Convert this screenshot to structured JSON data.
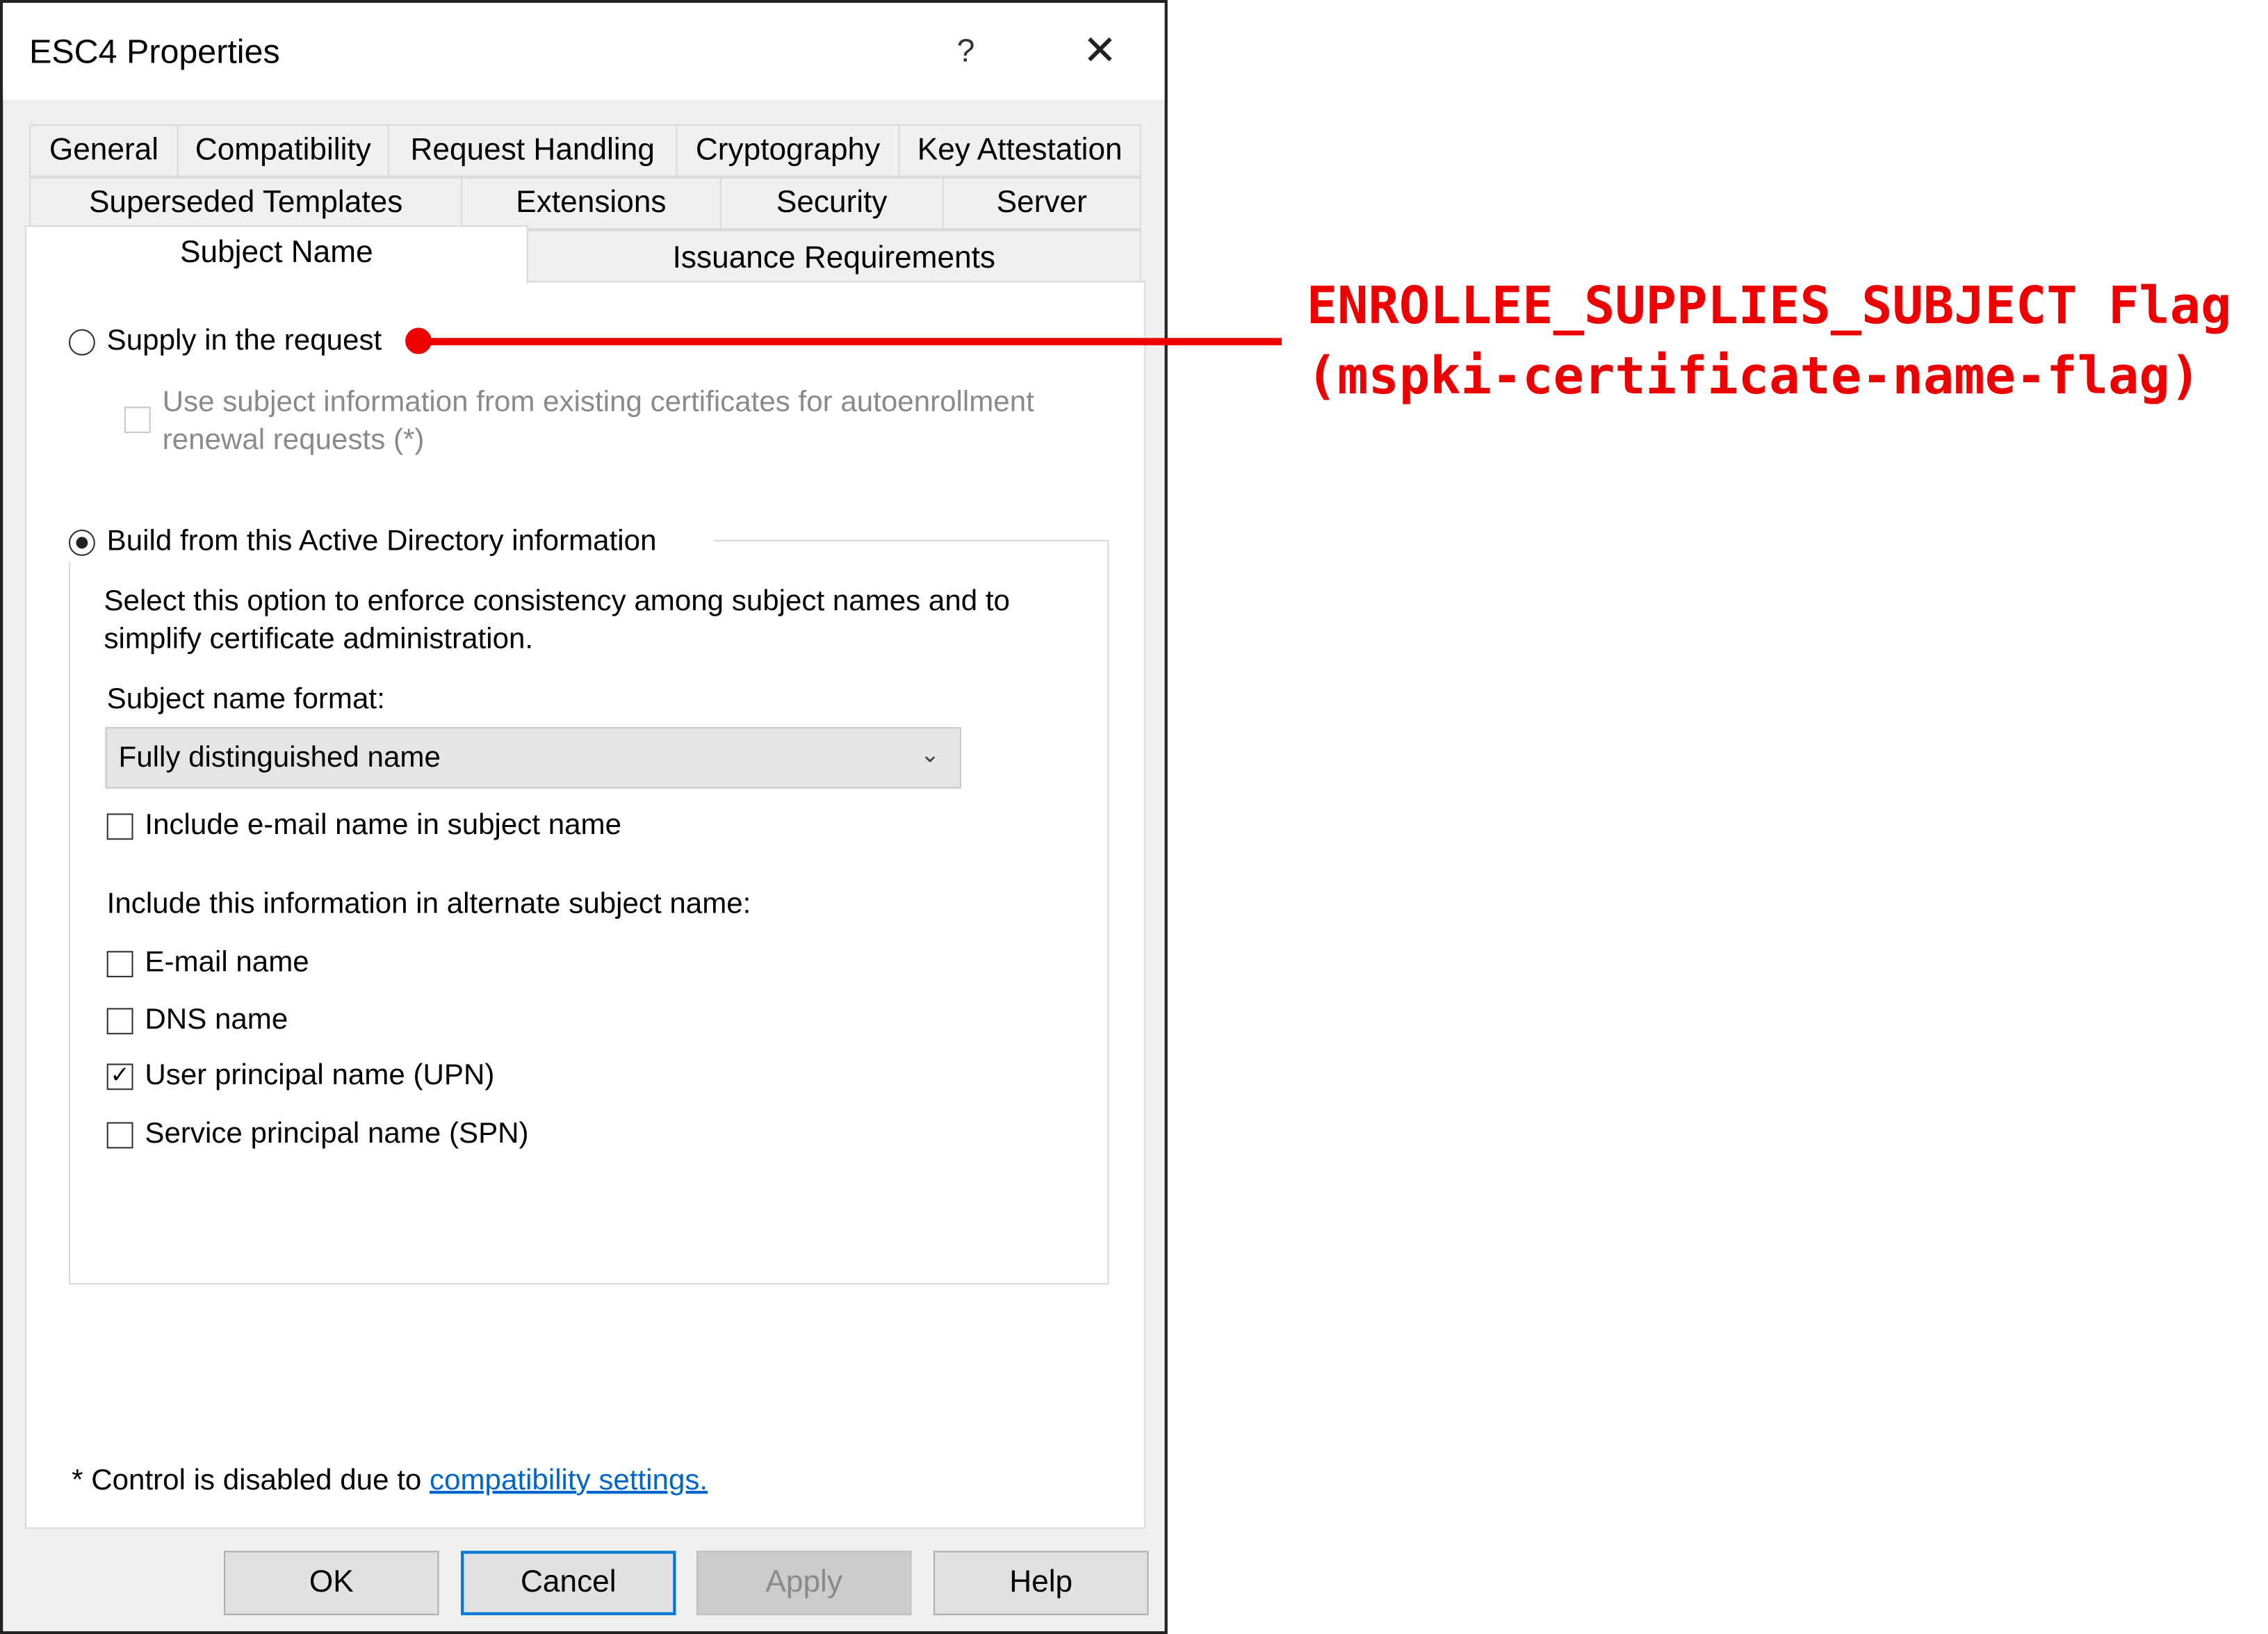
{
  "window": {
    "title": "ESC4 Properties",
    "help_label": "?",
    "close_label": "✕"
  },
  "tabs": {
    "row1": [
      "General",
      "Compatibility",
      "Request Handling",
      "Cryptography",
      "Key Attestation"
    ],
    "row2": [
      "Superseded Templates",
      "Extensions",
      "Security",
      "Server"
    ],
    "row3": [
      "Subject Name",
      "Issuance Requirements"
    ],
    "active": "Subject Name"
  },
  "subject": {
    "supply_label": "Supply in the request",
    "supply_selected": false,
    "autoenroll_label_1": "Use subject information from existing certificates for autoenrollment",
    "autoenroll_label_2": "renewal requests (*)",
    "autoenroll_checked": false,
    "build_label": "Build from this Active Directory information",
    "build_selected": true,
    "description_1": "Select this option to enforce consistency among subject names and to",
    "description_2": "simplify certificate administration.",
    "format_label": "Subject name format:",
    "format_value": "Fully distinguished name",
    "include_email_label": "Include e-mail name in subject name",
    "include_email_checked": false,
    "alt_label": "Include this information in alternate subject name:",
    "alt_options": [
      {
        "label": "E-mail name",
        "checked": false
      },
      {
        "label": "DNS name",
        "checked": false
      },
      {
        "label": "User principal name (UPN)",
        "checked": true
      },
      {
        "label": "Service principal name (SPN)",
        "checked": false
      }
    ],
    "footnote": "* Control is disabled due to ",
    "footnote_link": "compatibility settings."
  },
  "buttons": {
    "ok": "OK",
    "cancel": "Cancel",
    "apply": "Apply",
    "help": "Help"
  },
  "annotation": {
    "line1": "ENROLLEE_SUPPLIES_SUBJECT Flag",
    "line2": "(mspki-certificate-name-flag)",
    "color": "#ee0000"
  }
}
